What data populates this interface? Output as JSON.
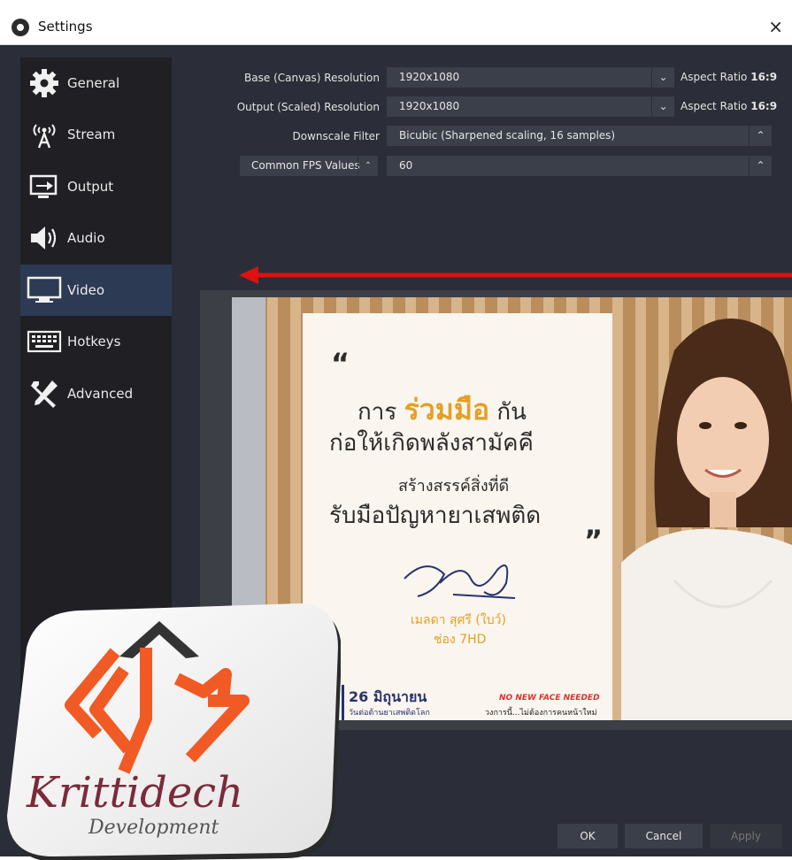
{
  "window": {
    "title": "Settings",
    "close_icon": "×"
  },
  "sidebar": {
    "items": [
      {
        "label": "General",
        "icon": "gear-icon"
      },
      {
        "label": "Stream",
        "icon": "broadcast-icon"
      },
      {
        "label": "Output",
        "icon": "output-icon"
      },
      {
        "label": "Audio",
        "icon": "speaker-icon"
      },
      {
        "label": "Video",
        "icon": "monitor-icon",
        "active": true
      },
      {
        "label": "Hotkeys",
        "icon": "keyboard-icon"
      },
      {
        "label": "Advanced",
        "icon": "tools-icon"
      }
    ]
  },
  "video": {
    "base_label": "Base (Canvas) Resolution",
    "base_value": "1920x1080",
    "base_aspect_label": "Aspect Ratio",
    "base_aspect_value": "16:9",
    "output_label": "Output (Scaled) Resolution",
    "output_value": "1920x1080",
    "output_aspect_label": "Aspect Ratio",
    "output_aspect_value": "16:9",
    "downscale_label": "Downscale Filter",
    "downscale_value": "Bicubic (Sharpened scaling, 16 samples)",
    "fps_label": "Common FPS Values",
    "fps_value": "60"
  },
  "preview": {
    "quote_open": "“",
    "quote_close": "”",
    "line1_pre": "การ",
    "line1_accent": "ร่วมมือ",
    "line1_post": "กัน",
    "line2": "ก่อให้เกิดพลังสามัคคี",
    "line3": "สร้างสรรค์สิ่งที่ดี",
    "line4": "รับมือปัญหายาเสพติด",
    "name1": "เมลดา สุศรี (ใบว์)",
    "name2": "ช่อง 7HD",
    "date_num": "26 มิถุนายน",
    "date_sub": "วันต่อต้านยาเสพติดโลก",
    "nnf": "NO NEW FACE NEEDED",
    "nnf_sub": "วงการนี้...ไม่ต้องการคนหน้าใหม่"
  },
  "buttons": {
    "ok": "OK",
    "cancel": "Cancel",
    "apply": "Apply"
  },
  "logo": {
    "text_main": "Krittidech",
    "text_sub": "Development"
  },
  "colors": {
    "accent": "#e3a025",
    "arrow": "#e01010",
    "sidebar_active": "#2d3a54",
    "logo_orange": "#f15a24"
  }
}
